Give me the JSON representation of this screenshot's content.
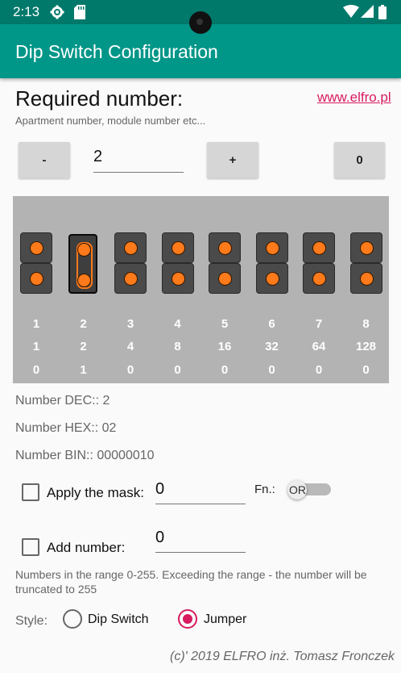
{
  "status_bar": {
    "time": "2:13"
  },
  "app": {
    "title": "Dip Switch Configuration"
  },
  "required": {
    "heading": "Required number:",
    "subtitle": "Apartment number, module number etc...",
    "link": "www.elfro.pl",
    "minus_label": "-",
    "plus_label": "+",
    "zero_label": "0",
    "value": "2"
  },
  "switch_panel": {
    "style_mode": "jumper",
    "positions": [
      "1",
      "2",
      "3",
      "4",
      "5",
      "6",
      "7",
      "8"
    ],
    "weights": [
      "1",
      "2",
      "4",
      "8",
      "16",
      "32",
      "64",
      "128"
    ],
    "bits": [
      "0",
      "1",
      "0",
      "0",
      "0",
      "0",
      "0",
      "0"
    ]
  },
  "results": {
    "dec": "Number DEC:: 2",
    "hex": "Number HEX:: 02",
    "bin": "Number BIN:: 00000010"
  },
  "mask": {
    "label": "Apply the mask:",
    "value": "0",
    "fn_label": "Fn.:",
    "toggle_label": "OR",
    "checked": false
  },
  "add": {
    "label": "Add number:",
    "value": "0",
    "checked": false
  },
  "note": "Numbers in the range 0-255. Exceeding the range - the number will be truncated to 255",
  "style": {
    "label": "Style:",
    "option_dip": "Dip Switch",
    "option_jumper": "Jumper",
    "selected": "Jumper"
  },
  "footer": "(c)' 2019 ELFRO inż. Tomasz Fronczek",
  "colors": {
    "appbar": "#009688",
    "statusbar": "#00796b",
    "accent": "#d81b60",
    "pin": "#ff7a1a"
  }
}
